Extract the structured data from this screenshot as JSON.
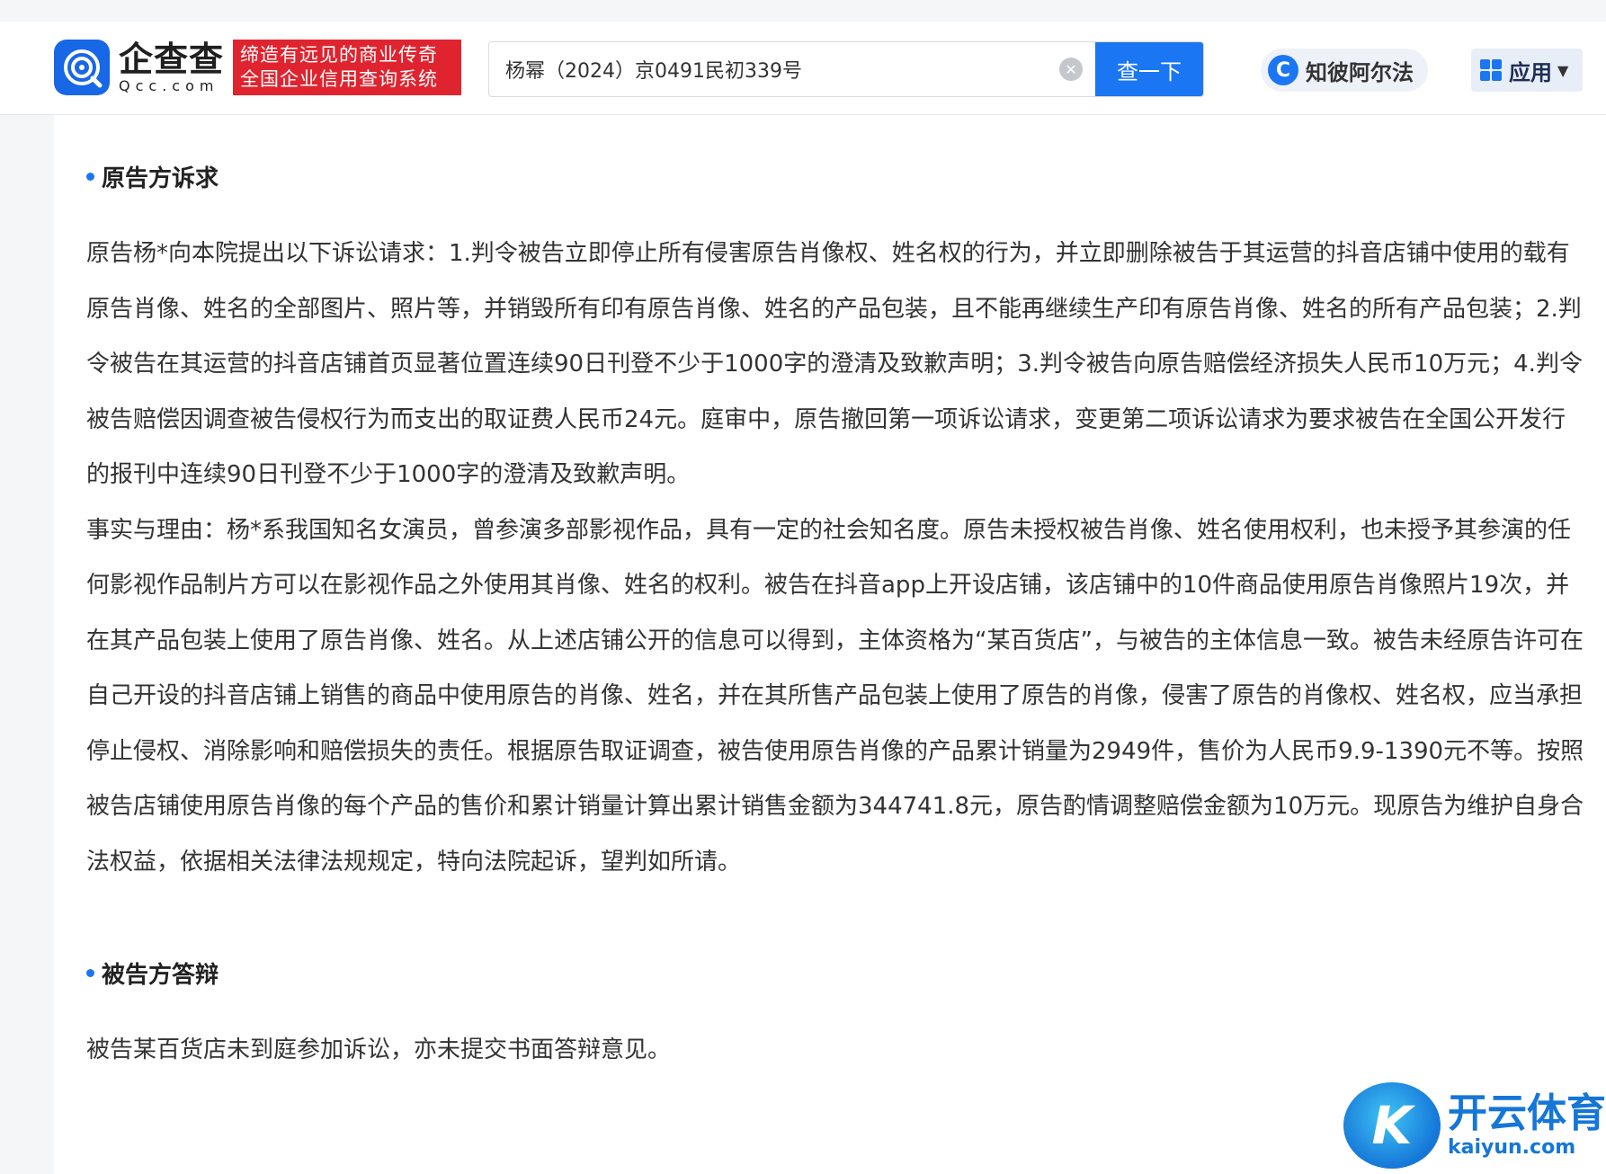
{
  "header": {
    "logo_cn": "企查查",
    "logo_en": "Qcc.com",
    "slogan_line1": "缔造有远见的商业传奇",
    "slogan_line2": "全国企业信用查询系统",
    "search_value": "杨幂（2024）京0491民初339号",
    "search_button": "查一下",
    "zbe_label": "知彼阿尔法",
    "apps_label": "应用"
  },
  "sections": [
    {
      "title": "原告方诉求",
      "paragraphs": [
        "原告杨*向本院提出以下诉讼请求：1.判令被告立即停止所有侵害原告肖像权、姓名权的行为，并立即删除被告于其运营的抖音店铺中使用的载有原告肖像、姓名的全部图片、照片等，并销毁所有印有原告肖像、姓名的产品包装，且不能再继续生产印有原告肖像、姓名的所有产品包装；2.判令被告在其运营的抖音店铺首页显著位置连续90日刊登不少于1000字的澄清及致歉声明；3.判令被告向原告赔偿经济损失人民币10万元；4.判令被告赔偿因调查被告侵权行为而支出的取证费人民币24元。庭审中，原告撤回第一项诉讼请求，变更第二项诉讼请求为要求被告在全国公开发行的报刊中连续90日刊登不少于1000字的澄清及致歉声明。",
        "事实与理由：杨*系我国知名女演员，曾参演多部影视作品，具有一定的社会知名度。原告未授权被告肖像、姓名使用权利，也未授予其参演的任何影视作品制片方可以在影视作品之外使用其肖像、姓名的权利。被告在抖音app上开设店铺，该店铺中的10件商品使用原告肖像照片19次，并在其产品包装上使用了原告肖像、姓名。从上述店铺公开的信息可以得到，主体资格为“某百货店”，与被告的主体信息一致。被告未经原告许可在自己开设的抖音店铺上销售的商品中使用原告的肖像、姓名，并在其所售产品包装上使用了原告的肖像，侵害了原告的肖像权、姓名权，应当承担停止侵权、消除影响和赔偿损失的责任。根据原告取证调查，被告使用原告肖像的产品累计销量为2949件，售价为人民币9.9-1390元不等。按照被告店铺使用原告肖像的每个产品的售价和累计销量计算出累计销售金额为344741.8元，原告酌情调整赔偿金额为10万元。现原告为维护自身合法权益，依据相关法律法规规定，特向法院起诉，望判如所请。"
      ]
    },
    {
      "title": "被告方答辩",
      "paragraphs": [
        "被告某百货店未到庭参加诉讼，亦未提交书面答辩意见。"
      ]
    }
  ],
  "watermark": {
    "cn": "开云体育",
    "en": "kaiyun.com"
  }
}
